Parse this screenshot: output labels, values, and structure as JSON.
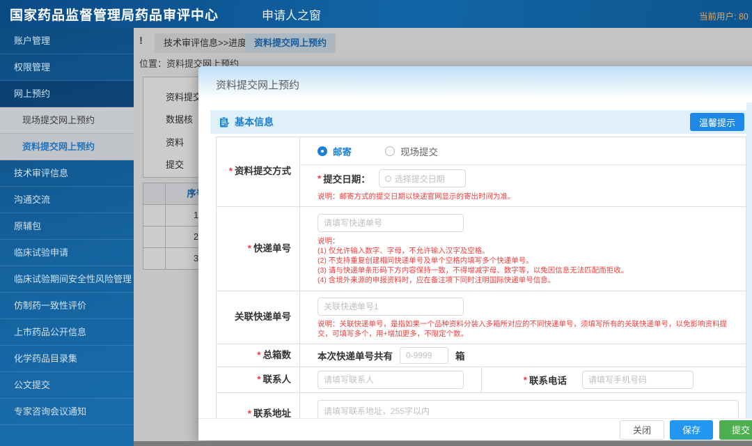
{
  "header": {
    "title": "国家药品监督管理局药品审评中心",
    "portal": "申请人之窗",
    "user": "当前用户: 80"
  },
  "sidebar": {
    "items": [
      {
        "label": "账户管理"
      },
      {
        "label": "权限管理"
      },
      {
        "label": "网上预约"
      },
      {
        "label": "现场提交网上预约"
      },
      {
        "label": "资料提交网上预约"
      },
      {
        "label": "技术审评信息"
      },
      {
        "label": "沟通交流"
      },
      {
        "label": "原辅包"
      },
      {
        "label": "临床试验申请"
      },
      {
        "label": "临床试验期间安全性风险管理"
      },
      {
        "label": "仿制药一致性评价"
      },
      {
        "label": "上市药品公开信息"
      },
      {
        "label": "化学药品目录集"
      },
      {
        "label": "公文提交"
      },
      {
        "label": "专家咨询会议通知"
      }
    ]
  },
  "tabs": {
    "alert": "!",
    "items": [
      {
        "label": "技术审评信息>>进度查询",
        "active": false
      },
      {
        "label": "资料提交网上预约",
        "active": true
      }
    ]
  },
  "breadcrumb": {
    "text": "位置：资料提交网上预约"
  },
  "bg": {
    "form_labels": [
      "资料提交方",
      "数据核",
      "资料",
      "提交"
    ],
    "table": {
      "header": "序号",
      "rows": [
        "1",
        "2",
        "3"
      ]
    }
  },
  "modal": {
    "title": "资料提交网上预约",
    "section_title": "基本信息",
    "tips_label": "温馨提示",
    "form": {
      "method": {
        "req": "*",
        "label": "资料提交方式",
        "mail_label": "邮寄",
        "onsite_label": "现场提交",
        "date_req": "*",
        "date_label": "提交日期：",
        "date_placeholder": "选择提交日期",
        "note": "说明：邮寄方式的提交日期以快递官网显示的寄出时间为准。"
      },
      "express": {
        "req": "*",
        "label": "快递单号",
        "placeholder": "请填写快递单号",
        "notes": [
          "说明：",
          "(1) 仅允许输入数字、字母，不允许输入汉字及空格。",
          "(2) 不支持重复创建相同快递单号及单个空格内填写多个快递单号。",
          "(3) 请与快递单条形码下方内容保持一致，不得增减字母、数字等，以免因信息无法匹配而拒收。",
          "(4) 含境外来源的申报资料时，应在备注项下同时注明国际快递单号信息。"
        ]
      },
      "related": {
        "label": "关联快递单号",
        "placeholder": "关联快递单号1",
        "note": "说明：关联快递单号，是指如果一个品种资料分装入多箱所对应的不同快递单号，须填写所有的关联快递单号，以免影响资料提交，可填写多个，用+增加更多，不限定个数。"
      },
      "boxes": {
        "req": "*",
        "label": "总箱数",
        "prefix": "本次快递单号共有",
        "placeholder": "0-9999",
        "suffix": "箱"
      },
      "contact": {
        "req": "*",
        "label": "联系人",
        "placeholder": "请填写联系人"
      },
      "phone": {
        "req": "*",
        "label": "联系电话",
        "placeholder": "请填写手机号码"
      },
      "address": {
        "req": "*",
        "label": "联系地址",
        "placeholder": "请填写联系地址，255字以内"
      }
    },
    "footer": {
      "close": "关闭",
      "save": "保存",
      "submit": "提交"
    }
  },
  "colors": {
    "accent_blue": "#1e80d0",
    "note_red": "#f03e3e",
    "save_blue": "#2196f3",
    "submit_green": "#4caf50",
    "tips_blue": "#1e88e5"
  }
}
